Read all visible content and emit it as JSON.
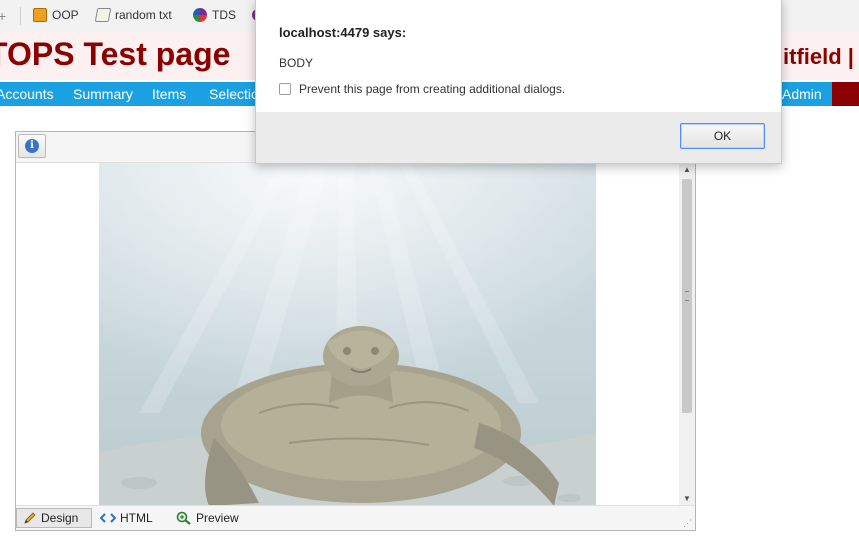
{
  "bookmarks": {
    "items": [
      {
        "label": "OOP",
        "icon": "gear-folder-icon"
      },
      {
        "label": "random txt",
        "icon": "document-icon"
      },
      {
        "label": "TDS",
        "icon": "colorful-circle-icon"
      }
    ]
  },
  "header": {
    "title": "TOPS Test page",
    "user": "itfield"
  },
  "nav": {
    "items": [
      "Accounts",
      "Summary",
      "Items",
      "Selection"
    ],
    "admin": "Admin"
  },
  "editor": {
    "toolbar_icon": "info-icon",
    "image_icon": "sea-turtle-photo",
    "modes": {
      "design": "Design",
      "html": "HTML",
      "preview": "Preview"
    }
  },
  "dialog": {
    "title": "localhost:4479 says:",
    "message": "BODY",
    "checkbox_label": "Prevent this page from creating additional dialogs.",
    "ok_label": "OK"
  },
  "colors": {
    "title_red": "#8b0000",
    "nav_blue": "#1ba1e2",
    "header_bg": "#fdf0f0"
  }
}
